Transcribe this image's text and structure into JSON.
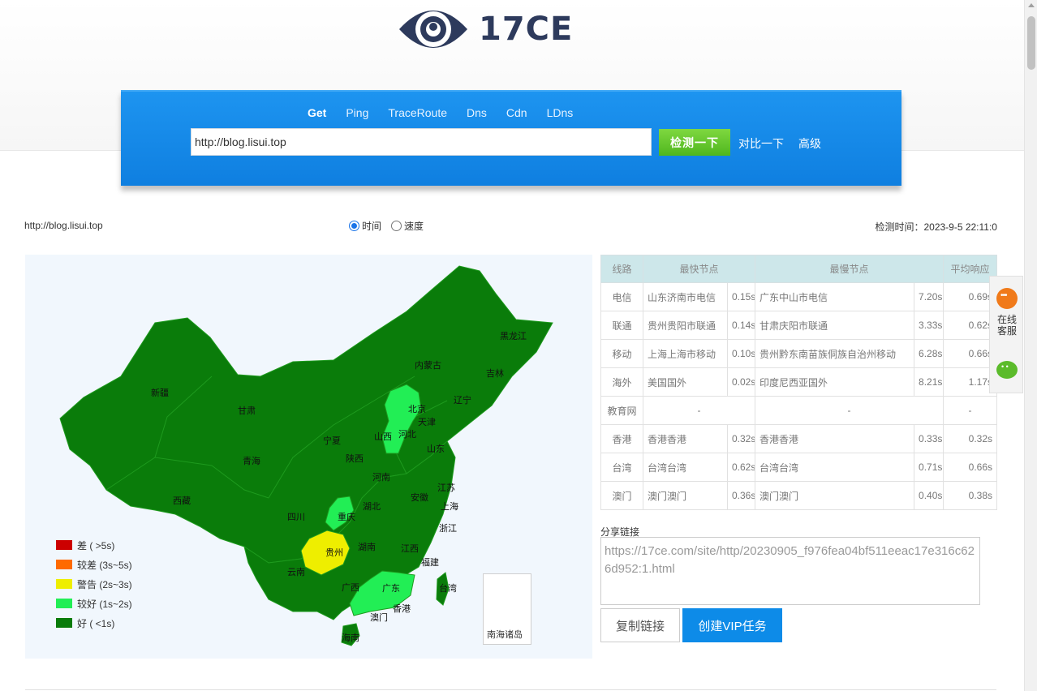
{
  "logo": {
    "text": "17CE"
  },
  "nav": {
    "tabs": [
      "Get",
      "Ping",
      "TraceRoute",
      "Dns",
      "Cdn",
      "LDns"
    ],
    "active": "Get"
  },
  "search": {
    "value": "http://blog.lisui.top",
    "check_label": "检测一下",
    "compare_label": "对比一下",
    "advanced_label": "高级"
  },
  "result": {
    "url": "http://blog.lisui.top",
    "options": [
      {
        "label": "时间",
        "checked": true
      },
      {
        "label": "速度",
        "checked": false
      }
    ],
    "time_label": "检测时间：2023-9-5 22:11:0"
  },
  "map": {
    "legend": [
      {
        "label": "差 ( >5s)",
        "color": "#cc0000"
      },
      {
        "label": "较差 (3s~5s)",
        "color": "#ff6a00"
      },
      {
        "label": "警告 (2s~3s)",
        "color": "#eeee00"
      },
      {
        "label": "较好 (1s~2s)",
        "color": "#22ee55"
      },
      {
        "label": "好 ( <1s)",
        "color": "#0a7c0a"
      }
    ],
    "provinces": [
      "新疆",
      "西藏",
      "青海",
      "甘肃",
      "内蒙古",
      "黑龙江",
      "吉林",
      "辽宁",
      "北京",
      "天津",
      "河北",
      "山西",
      "宁夏",
      "陕西",
      "山东",
      "河南",
      "江苏",
      "安徽",
      "上海",
      "湖北",
      "四川",
      "重庆",
      "浙江",
      "湖南",
      "江西",
      "贵州",
      "云南",
      "福建",
      "广西",
      "广东",
      "香港",
      "澳门",
      "台湾",
      "海南"
    ],
    "south_sea_label": "南海诸岛",
    "colors": {
      "good": "#0a7c0a",
      "better": "#22ee55",
      "warning": "#eeee00",
      "background": "#f1f7fd"
    }
  },
  "table": {
    "headers": [
      "线路",
      "最快节点",
      "最慢节点",
      "平均响应"
    ],
    "rows": [
      {
        "line": "电信",
        "fast_node": "山东济南市电信",
        "fast_time": "0.15s",
        "slow_node": "广东中山市电信",
        "slow_time": "7.20s",
        "avg": "0.69s"
      },
      {
        "line": "联通",
        "fast_node": "贵州贵阳市联通",
        "fast_time": "0.14s",
        "slow_node": "甘肃庆阳市联通",
        "slow_time": "3.33s",
        "avg": "0.62s"
      },
      {
        "line": "移动",
        "fast_node": "上海上海市移动",
        "fast_time": "0.10s",
        "slow_node": "贵州黔东南苗族侗族自治州移动",
        "slow_time": "6.28s",
        "avg": "0.66s"
      },
      {
        "line": "海外",
        "fast_node": "美国国外",
        "fast_time": "0.02s",
        "slow_node": "印度尼西亚国外",
        "slow_time": "8.21s",
        "avg": "1.17s"
      },
      {
        "line": "教育网",
        "fast_node": "-",
        "fast_time": "",
        "slow_node": "-",
        "slow_time": "",
        "avg": "-"
      },
      {
        "line": "香港",
        "fast_node": "香港香港",
        "fast_time": "0.32s",
        "slow_node": "香港香港",
        "slow_time": "0.33s",
        "avg": "0.32s"
      },
      {
        "line": "台湾",
        "fast_node": "台湾台湾",
        "fast_time": "0.62s",
        "slow_node": "台湾台湾",
        "slow_time": "0.71s",
        "avg": "0.66s"
      },
      {
        "line": "澳门",
        "fast_node": "澳门澳门",
        "fast_time": "0.36s",
        "slow_node": "澳门澳门",
        "slow_time": "0.40s",
        "avg": "0.38s"
      }
    ]
  },
  "share": {
    "title": "分享链接",
    "link": "https://17ce.com/site/http/20230905_f976fea04bf511eeac17e316c626d952:1.html",
    "copy_label": "复制链接",
    "vip_label": "创建VIP任务"
  },
  "side_widget": {
    "service_label": "在线客服"
  }
}
